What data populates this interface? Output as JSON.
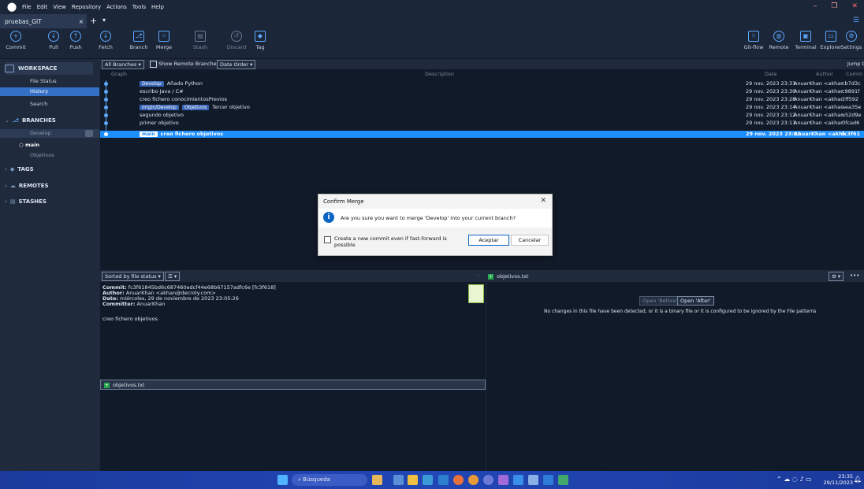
{
  "menubar": {
    "items": [
      "File",
      "Edit",
      "View",
      "Repository",
      "Actions",
      "Tools",
      "Help"
    ]
  },
  "tabbar": {
    "repo_tab": "pruebas_GIT",
    "close": "×",
    "plus": "+",
    "dropdown": "▾"
  },
  "toolbar": {
    "left": [
      {
        "label": "Commit",
        "icon": "plus-circle-icon",
        "glyph": "+"
      },
      {
        "label": "Pull",
        "icon": "arrow-down-icon",
        "glyph": "↓"
      },
      {
        "label": "Push",
        "icon": "arrow-up-icon",
        "glyph": "↑"
      },
      {
        "label": "Fetch",
        "icon": "fetch-icon",
        "glyph": "↓"
      },
      {
        "label": "Branch",
        "icon": "branch-icon",
        "glyph": "⎇"
      },
      {
        "label": "Merge",
        "icon": "merge-icon",
        "glyph": "⑂"
      },
      {
        "label": "Stash",
        "icon": "stash-icon",
        "glyph": "▤"
      },
      {
        "label": "Discard",
        "icon": "discard-icon",
        "glyph": "↺"
      },
      {
        "label": "Tag",
        "icon": "tag-icon",
        "glyph": "◆"
      }
    ],
    "right": [
      {
        "label": "Git-flow",
        "icon": "git-flow-icon",
        "glyph": "⑂"
      },
      {
        "label": "Remote",
        "icon": "globe-icon",
        "glyph": "◍"
      },
      {
        "label": "Terminal",
        "icon": "terminal-icon",
        "glyph": "▣"
      },
      {
        "label": "Explorer",
        "icon": "folder-icon",
        "glyph": "▭"
      },
      {
        "label": "Settings",
        "icon": "gear-icon",
        "glyph": "⚙"
      }
    ]
  },
  "sidebar": {
    "workspace": "WORKSPACE",
    "workspace_items": [
      "File Status",
      "History",
      "Search"
    ],
    "branches": "BRANCHES",
    "branch_items": [
      "Develop",
      "main",
      "Objetivos"
    ],
    "tags": "TAGS",
    "remotes": "REMOTES",
    "stashes": "STASHES"
  },
  "filterbar": {
    "all_branches": "All Branches ▾",
    "show_remote": "Show Remote Branches",
    "date_order": "Date Order ▾",
    "jump": "Jump t"
  },
  "table": {
    "headers": {
      "graph": "Graph",
      "description": "Description",
      "date": "Date",
      "author": "Author",
      "commit": "Comm"
    },
    "rows": [
      {
        "tags": [
          "Develop"
        ],
        "desc": "Añado Python",
        "date": "29 nov. 2023 23:31",
        "author": "AnuarKhan <akhar",
        "hash": "cb7d3c"
      },
      {
        "tags": [],
        "desc": "escribo Java / C#",
        "date": "29 nov. 2023 23:30",
        "author": "AnuarKhan <akhar",
        "hash": "c9891f"
      },
      {
        "tags": [],
        "desc": "creo fichero conocimientosPrevios",
        "date": "29 nov. 2023 23:28",
        "author": "AnuarKhan <akhar",
        "hash": "2ff592"
      },
      {
        "tags": [
          "origin/Develop",
          "Objetivos"
        ],
        "desc": "Tercer objetivo",
        "date": "29 nov. 2023 23:14",
        "author": "AnuarKhan <akhar",
        "hash": "aea35e"
      },
      {
        "tags": [],
        "desc": "segundo objetivo",
        "date": "29 nov. 2023 23:12",
        "author": "AnuarKhan <akhar",
        "hash": "e52d9e"
      },
      {
        "tags": [],
        "desc": "primer objetivo",
        "date": "29 nov. 2023 23:11",
        "author": "AnuarKhan <akhar",
        "hash": "0fcad6"
      },
      {
        "tags": [
          "main"
        ],
        "desc": "creo fichero objetivos",
        "date": "29 nov. 2023 23:01",
        "author": "AnuarKhan <akha",
        "hash": "fc3f61"
      }
    ]
  },
  "dialog": {
    "title": "Confirm Merge",
    "close": "✕",
    "message": "Are you sure you want to merge 'Develop' into your current branch?",
    "checkbox_label": "Create a new commit even if fast-forward is possible",
    "accept": "Aceptar",
    "cancel": "Cancelar"
  },
  "lower": {
    "sort": "Sorted by file status ▾",
    "view": "☰ ▾",
    "file_name": "objetivos.txt",
    "gear": "⚙ ▾",
    "more": "•••"
  },
  "commit_detail": {
    "commit_label": "Commit:",
    "commit_value": "fc3f61845bd6c687460edcf44e68b67157adfc6e [fc3f618]",
    "author_label": "Author:",
    "author_value": "AnuarKhan <akhan@decroly.com>",
    "date_label": "Date:",
    "date_value": "miércoles, 29 de noviembre de 2023 23:05:26",
    "committer_label": "Committer:",
    "committer_value": "AnuarKhan",
    "message": "creo fichero  objetivos"
  },
  "diff": {
    "open_before": "Open 'Before'",
    "open_after": "Open 'After'",
    "notice": "No changes in this file have been detected, or it is a binary file or it is configured to be ignored by the File patterns"
  },
  "taskbar": {
    "search": "Búsqueda",
    "time": "23:35",
    "date": "29/11/2023"
  },
  "colors": {
    "accent": "#1e8fff",
    "dialog_info": "#0a66c2",
    "file_added": "#25a84b"
  }
}
